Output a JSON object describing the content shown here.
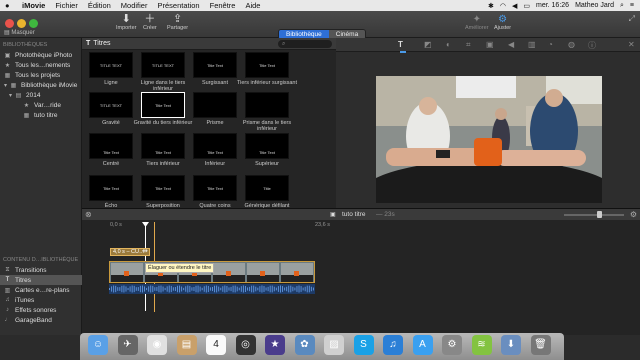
{
  "menubar": {
    "apple": "",
    "items": [
      "iMovie",
      "Fichier",
      "Édition",
      "Modifier",
      "Présentation",
      "Fenêtre",
      "Aide"
    ],
    "clock": "mer. 16:26",
    "user": "Matheo Jard"
  },
  "toolbar": {
    "hide_label": "Masquer",
    "import_label": "Importer",
    "create_label": "Créer",
    "share_label": "Partager",
    "library_tab": "Bibliothèque",
    "cinema_tab": "Cinéma",
    "enhance_label": "Améliorer",
    "adjust_label": "Ajuster"
  },
  "sidebar": {
    "libraries_header": "BIBLIOTHÈQUES",
    "items": [
      {
        "label": "Photothèque iPhoto",
        "icon": "camera-icon"
      },
      {
        "label": "Tous les…nements",
        "icon": "star-icon"
      },
      {
        "label": "Tous les projets",
        "icon": "film-icon"
      },
      {
        "label": "Bibliothèque iMovie",
        "icon": "grid-icon"
      },
      {
        "label": "2014",
        "icon": "folder-icon"
      },
      {
        "label": "Var…ride",
        "icon": "star-icon"
      },
      {
        "label": "tuto titre",
        "icon": "film-icon"
      }
    ],
    "content_header": "CONTENU D…IBLIOTHÈQUE",
    "content_items": [
      {
        "label": "Transitions",
        "icon": "transition-icon"
      },
      {
        "label": "Titres",
        "icon": "title-icon"
      },
      {
        "label": "Cartes e…re-plans",
        "icon": "map-icon"
      },
      {
        "label": "iTunes",
        "icon": "music-icon"
      },
      {
        "label": "Effets sonores",
        "icon": "sound-icon"
      },
      {
        "label": "GarageBand",
        "icon": "guitar-icon"
      }
    ]
  },
  "browser": {
    "title": "Titres",
    "search_placeholder": "",
    "tiles": [
      {
        "label": "Ligne",
        "preview": "TITLE TEXT"
      },
      {
        "label": "Ligne dans le tiers inférieur",
        "preview": "TITLE TEXT"
      },
      {
        "label": "Surgissant",
        "preview": "Title Text"
      },
      {
        "label": "Tiers inférieur surgissant",
        "preview": "Title Text"
      },
      {
        "label": "Gravité",
        "preview": "TITLE TEXT"
      },
      {
        "label": "Gravité du tiers inférieur",
        "preview": "Title Text"
      },
      {
        "label": "Prisme",
        "preview": ""
      },
      {
        "label": "Prisme dans le tiers inférieur",
        "preview": ""
      },
      {
        "label": "Centré",
        "preview": "Title Text"
      },
      {
        "label": "Tiers inférieur",
        "preview": "Title Text"
      },
      {
        "label": "Inférieur",
        "preview": "Title Text"
      },
      {
        "label": "Supérieur",
        "preview": "Title Text"
      },
      {
        "label": "Écho",
        "preview": "Title Text"
      },
      {
        "label": "Superposition",
        "preview": "Title Text"
      },
      {
        "label": "Quatre coins",
        "preview": "Title Text"
      },
      {
        "label": "Générique défilant",
        "preview": "Title"
      }
    ]
  },
  "timeline": {
    "project_title": "tuto titre",
    "duration": "— 23s",
    "ruler_start": "0,0 s",
    "ruler_end": "23,6 s",
    "title_clip_label": "4,0 s – CU…",
    "tooltip": "Élaguer ou étendre le titre"
  },
  "dock": {
    "icons": [
      "finder-icon",
      "launchpad-icon",
      "chrome-icon",
      "contacts-icon",
      "calendar-icon",
      "photobooth-icon",
      "imovie-icon",
      "iphoto-icon",
      "preview-icon",
      "skype-icon",
      "itunes-icon",
      "appstore-icon",
      "systemprefs-icon",
      "spotify-icon",
      "downloads-icon",
      "trash-icon"
    ],
    "calendar_day": "4"
  },
  "colors": {
    "accent": "#2e6fd6",
    "title_clip": "#9b7a3b",
    "playhead": "#e0a84c"
  }
}
